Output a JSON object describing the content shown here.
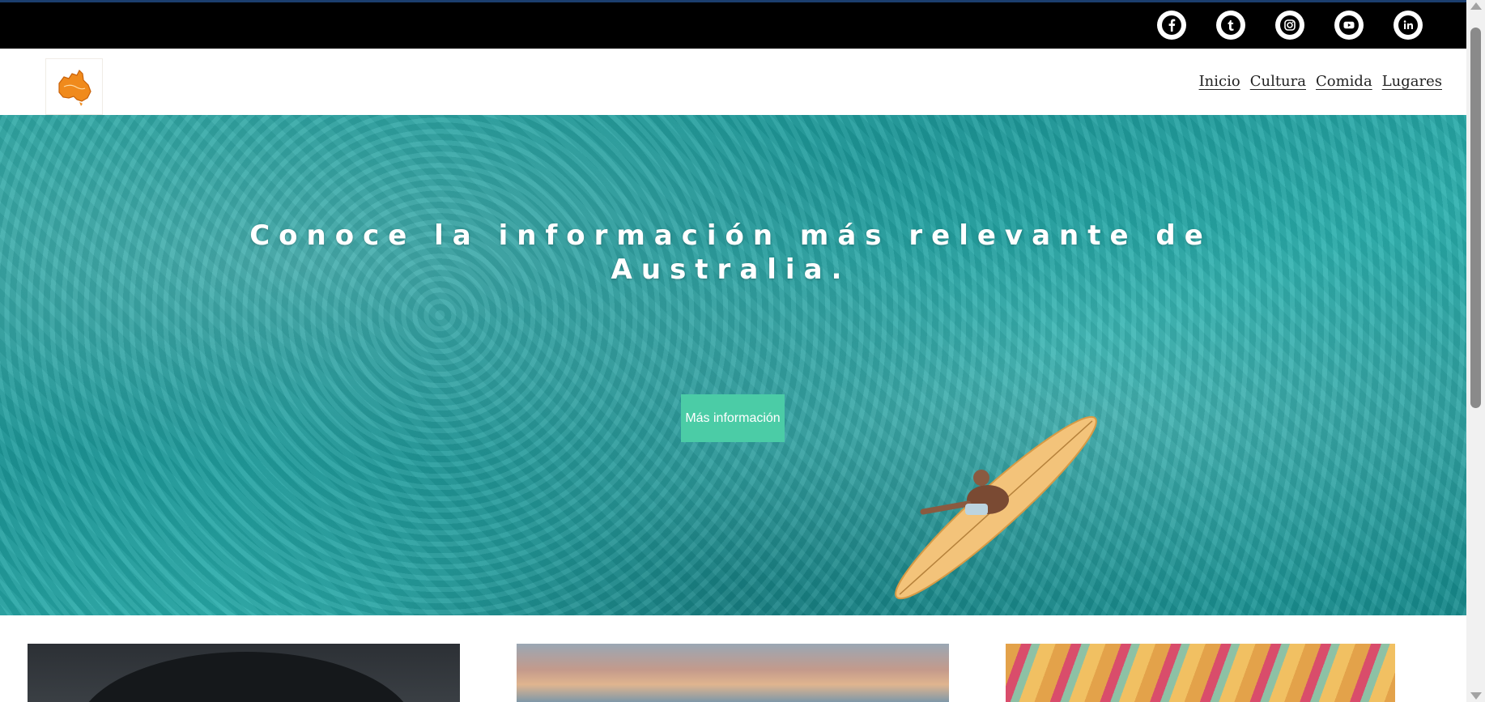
{
  "social": {
    "items": [
      {
        "name": "facebook",
        "glyph": "f"
      },
      {
        "name": "tumblr",
        "glyph": "t"
      },
      {
        "name": "instagram",
        "glyph": ""
      },
      {
        "name": "youtube",
        "glyph": ""
      },
      {
        "name": "linkedin",
        "glyph": "in"
      }
    ]
  },
  "header": {
    "logo_alt": "Australia map logo",
    "nav": [
      "Inicio",
      "Cultura",
      "Comida",
      "Lugares"
    ]
  },
  "hero": {
    "title": "Conoce la información más relevante de Australia.",
    "button_label": "Más información"
  },
  "colors": {
    "topbar": "#000000",
    "button": "#4bcca6",
    "water": "#2aa7a4"
  }
}
